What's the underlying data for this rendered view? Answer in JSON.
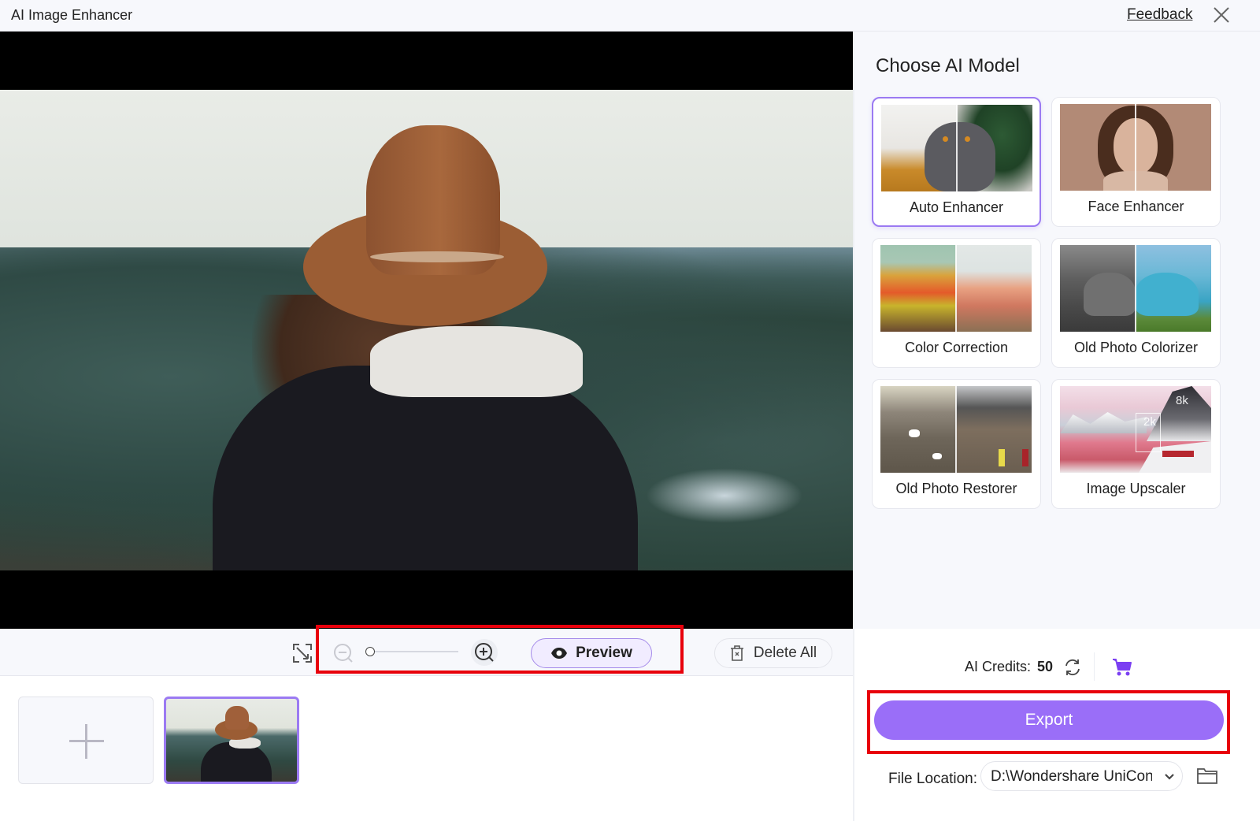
{
  "window": {
    "title": "AI Image Enhancer",
    "feedback_link": "Feedback",
    "close_icon": "close-icon"
  },
  "toolbar": {
    "fit_icon": "fit-screen-icon",
    "zoom_out_icon": "zoom-out-icon",
    "zoom_in_icon": "zoom-in-icon",
    "zoom_slider_value": 0,
    "preview_label": "Preview",
    "preview_icon": "eye-icon",
    "delete_all_label": "Delete All",
    "delete_icon": "trash-icon"
  },
  "thumbnails": {
    "add_icon": "plus-icon",
    "items": [
      {
        "name": "woman-in-hat-forest",
        "selected": true
      }
    ]
  },
  "right_panel": {
    "title": "Choose AI Model",
    "models": [
      {
        "label": "Auto Enhancer",
        "selected": true
      },
      {
        "label": "Face Enhancer",
        "selected": false
      },
      {
        "label": "Color Correction",
        "selected": false
      },
      {
        "label": "Old Photo Colorizer",
        "selected": false
      },
      {
        "label": "Old Photo Restorer",
        "selected": false
      },
      {
        "label": "Image Upscaler",
        "selected": false,
        "badges": [
          "2k",
          "8k"
        ]
      }
    ]
  },
  "footer": {
    "credits_label": "AI Credits:",
    "credits_value": "50",
    "refresh_icon": "refresh-icon",
    "cart_icon": "cart-icon",
    "export_label": "Export",
    "file_location_label": "File Location:",
    "file_location_value": "D:\\Wondershare UniConverter",
    "folder_icon": "folder-icon"
  },
  "colors": {
    "accent": "#9a6ef8",
    "selected_border": "#9b7af2",
    "highlight_annotation": "#e8000b",
    "cart": "#7b3ff2"
  }
}
